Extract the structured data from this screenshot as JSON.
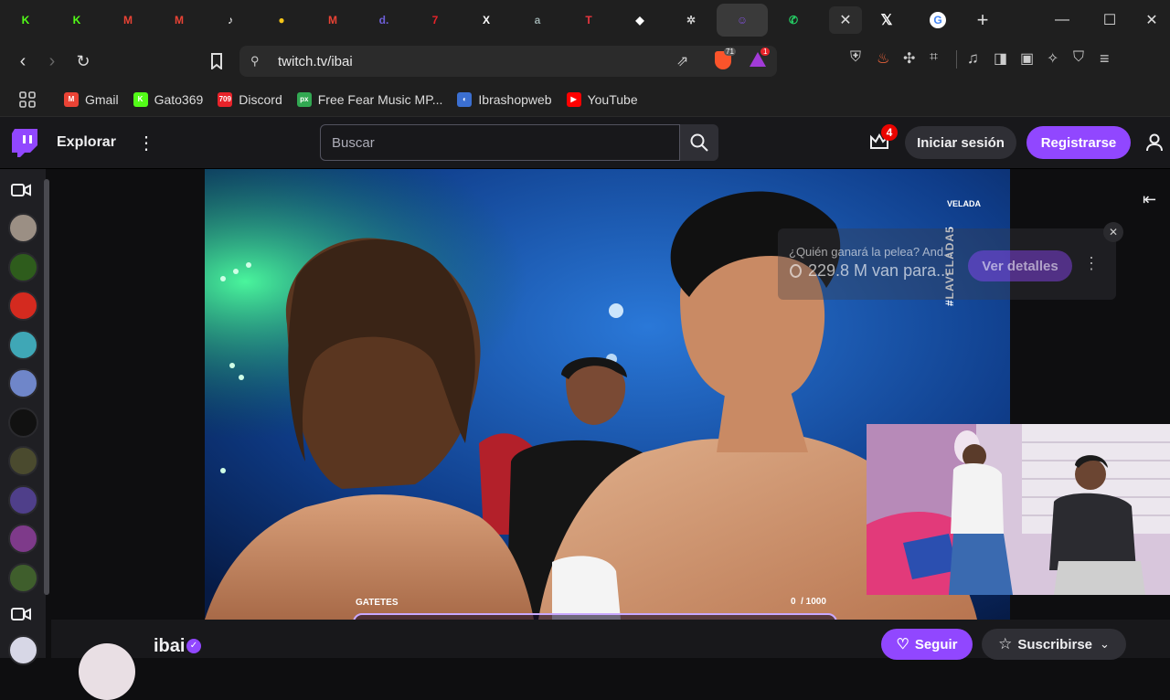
{
  "browser": {
    "tabs": [
      {
        "icon": "kick-icon",
        "letter": "K",
        "color": "#53fc18",
        "active": false
      },
      {
        "icon": "kick-icon",
        "letter": "K",
        "color": "#53fc18",
        "active": false
      },
      {
        "icon": "gmail-icon",
        "letter": "M",
        "color": "#ea4335",
        "active": false
      },
      {
        "icon": "gmail-icon",
        "letter": "M",
        "color": "#ea4335",
        "active": false
      },
      {
        "icon": "tiktok-icon",
        "letter": "♪",
        "color": "#ffffff",
        "active": false
      },
      {
        "icon": "yellow-circle-icon",
        "letter": "●",
        "color": "#f5c518",
        "active": false
      },
      {
        "icon": "gmail-icon",
        "letter": "M",
        "color": "#ea4335",
        "active": false
      },
      {
        "icon": "d-icon",
        "letter": "d.",
        "color": "#6e5fd8",
        "active": false
      },
      {
        "icon": "711-icon",
        "letter": "7",
        "color": "#e8232a",
        "active": false
      },
      {
        "icon": "x-icon",
        "letter": "X",
        "color": "#ffffff",
        "active": false
      },
      {
        "icon": "a-icon",
        "letter": "a",
        "color": "#9aa",
        "active": false
      },
      {
        "icon": "red-square-icon",
        "letter": "T",
        "color": "#e8363f",
        "active": false
      },
      {
        "icon": "diamond-icon",
        "letter": "◆",
        "color": "#ffffff",
        "active": false
      },
      {
        "icon": "openai-icon",
        "letter": "✲",
        "color": "#cccccc",
        "active": false
      },
      {
        "icon": "twitch-tab-icon",
        "letter": "☺",
        "color": "#7f4fd6",
        "active": true
      },
      {
        "icon": "whatsapp-icon",
        "letter": "✆",
        "color": "#25d366",
        "active": false
      }
    ],
    "url": "twitch.tv/ibai",
    "extension_badge": "1",
    "shield_badge": "71",
    "bookmarks": [
      {
        "label": "Gmail",
        "icon": "gmail-icon",
        "color": "#ea4335",
        "glyph": "M"
      },
      {
        "label": "Gato369",
        "icon": "kick-icon",
        "color": "#53fc18",
        "glyph": "K"
      },
      {
        "label": "Discord",
        "icon": "discord-icon",
        "color": "#e8232a",
        "glyph": "709"
      },
      {
        "label": "Free Fear Music MP...",
        "icon": "px-icon",
        "color": "#32a852",
        "glyph": "px"
      },
      {
        "label": "Ibrashopweb",
        "icon": "ibrashop-icon",
        "color": "#3b6fd1",
        "glyph": "◐"
      },
      {
        "label": "YouTube",
        "icon": "youtube-icon",
        "color": "#ff0000",
        "glyph": "▶"
      }
    ]
  },
  "twitch": {
    "explore_label": "Explorar",
    "search_placeholder": "Buscar",
    "notification_count": "4",
    "login_label": "Iniciar sesión",
    "signup_label": "Registrarse",
    "prediction": {
      "question": "¿Quién ganará la pelea? And...",
      "amount": "229.8 M van para...",
      "details_label": "Ver detalles"
    },
    "overlay": {
      "brand": "VELADA",
      "hashtag": "#LAVELADA5",
      "gatetes_label": "GATETES",
      "counter": "0  / 1000"
    },
    "channel": {
      "name": "ibai",
      "follow_label": "Seguir",
      "subscribe_label": "Suscribirse"
    },
    "sidebar_avatars": [
      {
        "color": "#9b8f84"
      },
      {
        "color": "#2e5c1c"
      },
      {
        "color": "#d42a1f"
      },
      {
        "color": "#3fa7b6"
      },
      {
        "color": "#6f86c9"
      },
      {
        "color": "#111111"
      },
      {
        "color": "#4a4a2e"
      },
      {
        "color": "#4f3f8a"
      },
      {
        "color": "#7e3a8a"
      },
      {
        "color": "#3f5e2c"
      }
    ],
    "colors": {
      "accent": "#9147ff",
      "topbar": "#18181b"
    }
  }
}
